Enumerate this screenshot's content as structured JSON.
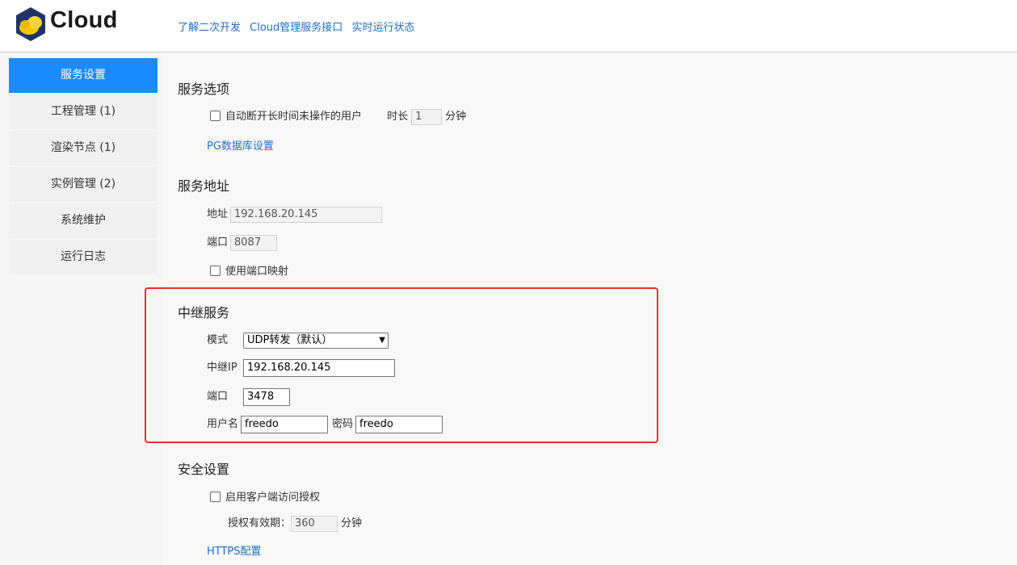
{
  "header": {
    "logo_text": "Cloud",
    "links": [
      "了解二次开发",
      "Cloud管理服务接口",
      "实时运行状态"
    ]
  },
  "sidebar": {
    "items": [
      {
        "label": "服务设置",
        "active": true
      },
      {
        "label": "工程管理 (1)"
      },
      {
        "label": "渲染节点 (1)"
      },
      {
        "label": "实例管理 (2)"
      },
      {
        "label": "系统维护"
      },
      {
        "label": "运行日志"
      }
    ]
  },
  "service_options": {
    "title": "服务选项",
    "auto_disconnect_label": "自动断开长时间未操作的用户",
    "duration_label": "时长",
    "duration_value": "1",
    "duration_unit": "分钟",
    "pg_link": "PG数据库设置"
  },
  "service_address": {
    "title": "服务地址",
    "address_label": "地址",
    "address_value": "192.168.20.145",
    "port_label": "端口",
    "port_value": "8087",
    "port_mapping_label": "使用端口映射"
  },
  "relay_service": {
    "title": "中继服务",
    "mode_label": "模式",
    "mode_value": "UDP转发（默认）",
    "relay_ip_label": "中继IP",
    "relay_ip_value": "192.168.20.145",
    "port_label": "端口",
    "port_value": "3478",
    "username_label": "用户名",
    "username_value": "freedo",
    "password_label": "密码",
    "password_value": "freedo"
  },
  "security": {
    "title": "安全设置",
    "client_auth_label": "启用客户端访问授权",
    "validity_label": "授权有效期：",
    "validity_value": "360",
    "validity_unit": "分钟",
    "https_link": "HTTPS配置"
  },
  "colors": {
    "accent": "#1a8cff",
    "link": "#1e6fc4",
    "highlight_box": "#ef2c2c"
  }
}
